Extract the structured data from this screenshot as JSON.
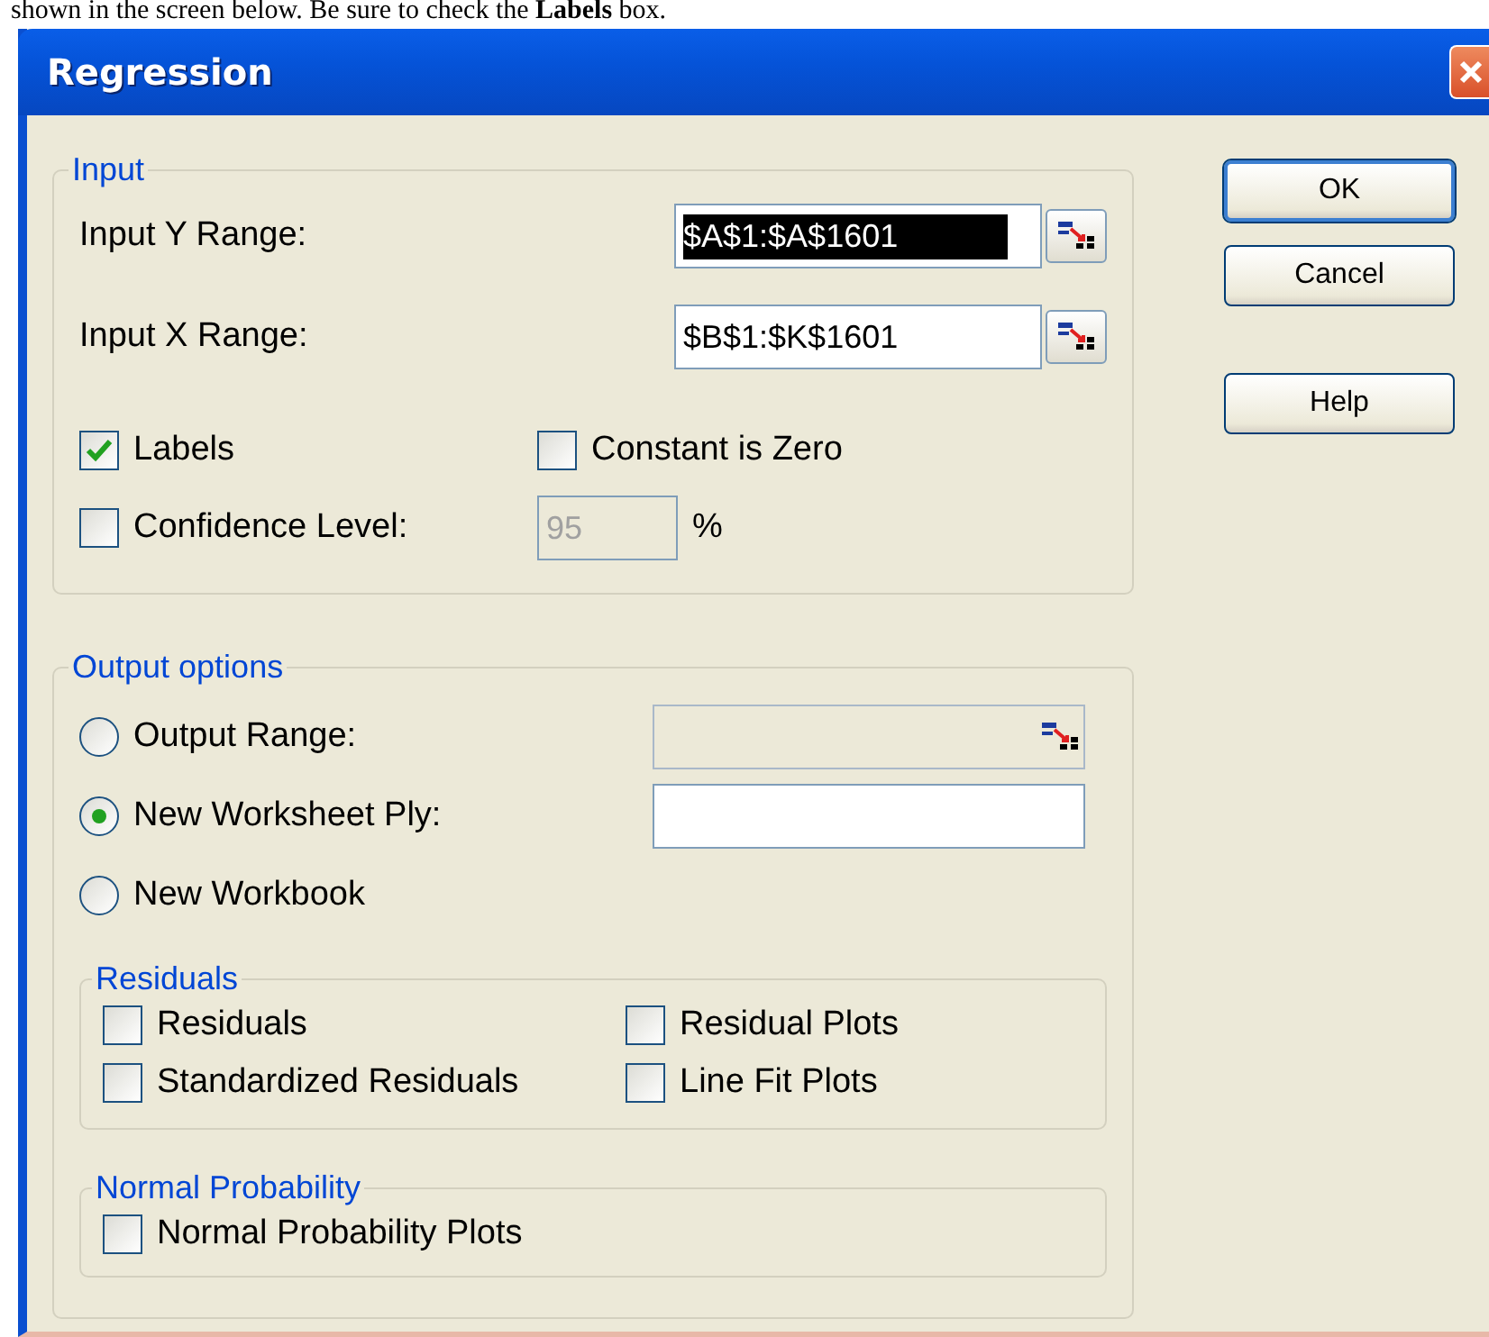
{
  "caption": "shown in the screen below. Be sure to check the **Labels** box.",
  "window": {
    "title": "Regression"
  },
  "input": {
    "legend": "Input",
    "ranges": [
      {
        "label": "Input Y Range:",
        "value": "$A$1:$A$1601",
        "text_selected": true
      },
      {
        "label": "Input X Range:",
        "value": "$B$1:$K$1601",
        "text_selected": false
      }
    ],
    "labels": {
      "label": "Labels",
      "checked": true
    },
    "constant_is_zero": {
      "label": "Constant is Zero",
      "checked": false
    },
    "confidence": {
      "label": "Confidence Level:",
      "checked": false,
      "value": "95",
      "disabled": true,
      "unit": "%"
    }
  },
  "output_options": {
    "legend": "Output options",
    "choices": [
      {
        "label": "Output Range:",
        "selected": false,
        "kind": "range",
        "disabled": true
      },
      {
        "label": "New Worksheet Ply:",
        "selected": true,
        "kind": "text",
        "disabled": false
      },
      {
        "label": "New Workbook",
        "selected": false,
        "kind": "none"
      }
    ],
    "residuals": {
      "legend": "Residuals",
      "options": [
        {
          "label": "Residuals",
          "checked": false
        },
        {
          "label": "Residual Plots",
          "checked": false
        },
        {
          "label": "Standardized Residuals",
          "checked": false
        },
        {
          "label": "Line Fit Plots",
          "checked": false
        }
      ]
    },
    "normal_probability": {
      "legend": "Normal Probability",
      "options": [
        {
          "label": "Normal Probability Plots",
          "checked": false
        }
      ]
    }
  },
  "buttons": [
    {
      "label": "OK",
      "default": true
    },
    {
      "label": "Cancel",
      "default": false
    },
    {
      "label": "Help",
      "default": false
    }
  ]
}
